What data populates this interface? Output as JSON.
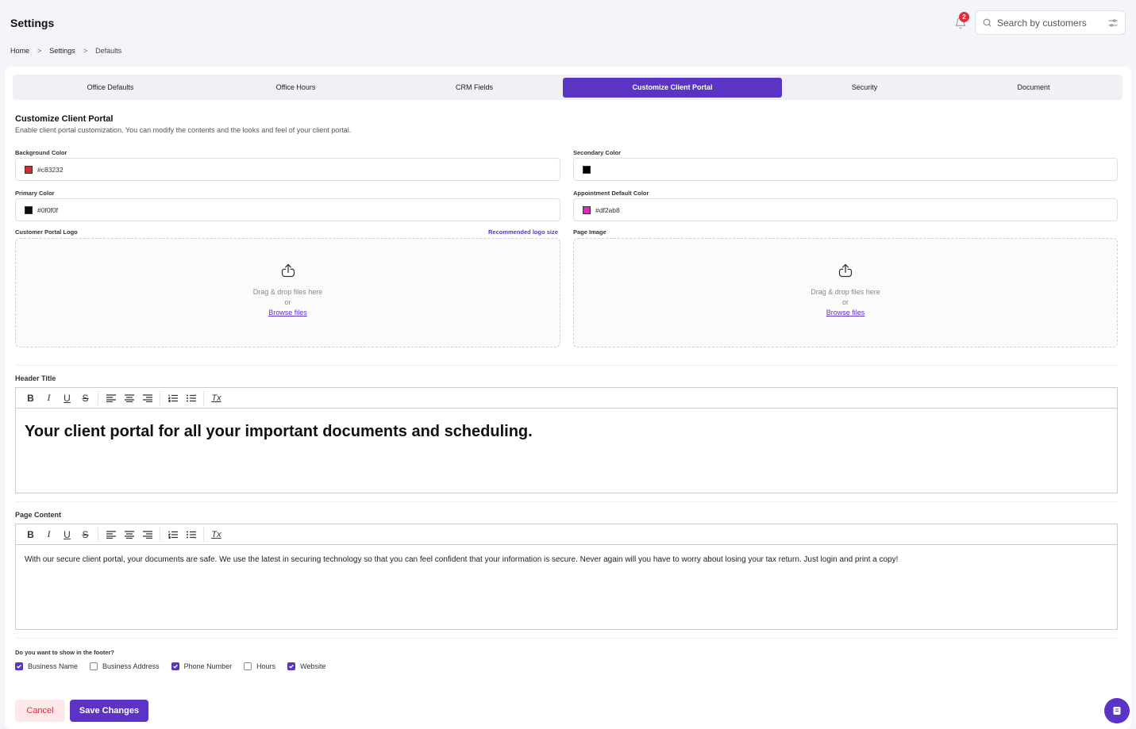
{
  "header": {
    "title": "Settings",
    "breadcrumb": [
      "Home",
      "Settings",
      "Defaults"
    ],
    "breadcrumb_separator": ">",
    "notifications_count": "2",
    "search_placeholder": "Search by customers"
  },
  "tabs": [
    {
      "label": "Office Defaults",
      "active": false
    },
    {
      "label": "Office Hours",
      "active": false
    },
    {
      "label": "CRM Fields",
      "active": false
    },
    {
      "label": "Customize Client Portal",
      "active": true
    },
    {
      "label": "Security",
      "active": false
    },
    {
      "label": "Document",
      "active": false
    }
  ],
  "section": {
    "title": "Customize Client Portal",
    "subtitle": "Enable client portal customization. You can modify the contents and the looks and feel of your client portal."
  },
  "colors": {
    "background": {
      "label": "Background Color",
      "value": "#c83232",
      "swatch": "#c83232"
    },
    "secondary": {
      "label": "Secondary Color",
      "value": "",
      "swatch": "#000000"
    },
    "primary": {
      "label": "Primary Color",
      "value": "#0f0f0f",
      "swatch": "#0f0f0f"
    },
    "appointment": {
      "label": "Appointment Default Color",
      "value": "#df2ab8",
      "swatch": "#df2ab8"
    }
  },
  "uploads": {
    "logo_label": "Customer Portal Logo",
    "logo_hint_link": "Recommended logo size",
    "page_image_label": "Page Image",
    "drag_text": "Drag & drop files here",
    "or_text": "or",
    "browse_text": "Browse files"
  },
  "header_title": {
    "label": "Header Title",
    "content": "Your client portal for all your important documents and scheduling."
  },
  "page_content": {
    "label": "Page Content",
    "content": "With our secure client portal, your documents are safe. We use the latest in securing technology so that you can feel confident that your information is secure. Never again will you have to worry about losing your tax return. Just login and print a copy!"
  },
  "toolbar": {
    "bold": "B",
    "italic": "I",
    "underline": "U",
    "strike": "S",
    "clear": "Tx"
  },
  "footer_options": {
    "question": "Do you want to show in the footer?",
    "items": [
      {
        "label": "Business Name",
        "checked": true
      },
      {
        "label": "Business Address",
        "checked": false
      },
      {
        "label": "Phone Number",
        "checked": true
      },
      {
        "label": "Hours",
        "checked": false
      },
      {
        "label": "Website",
        "checked": true
      }
    ]
  },
  "actions": {
    "cancel": "Cancel",
    "save": "Save Changes"
  },
  "theme": {
    "accent": "#5b34c6",
    "badge": "#e02e3c",
    "cancel_bg": "#fde9ea",
    "cancel_text": "#d9303f"
  },
  "icons": {
    "notification": "bell-icon",
    "search": "search-icon",
    "filter": "sliders-icon",
    "upload": "upload-cloud-icon",
    "chat": "chat-icon"
  }
}
